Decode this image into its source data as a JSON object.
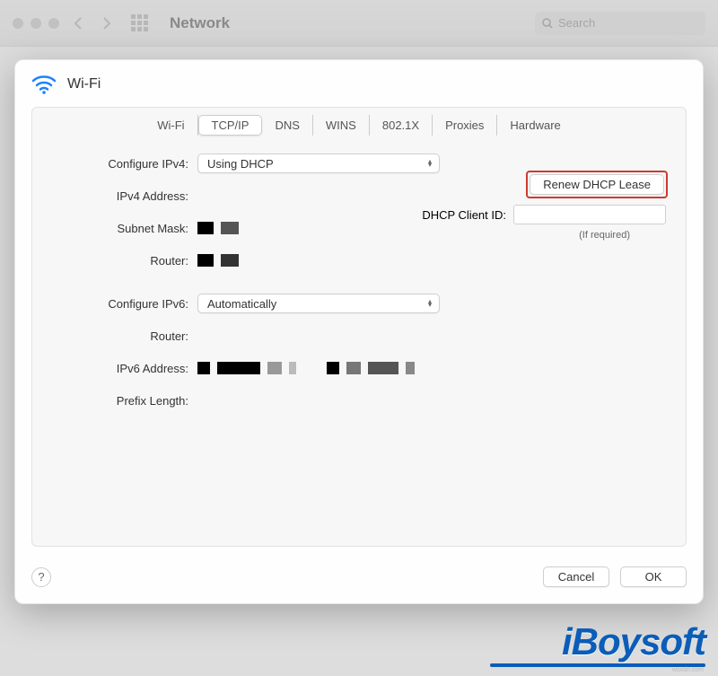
{
  "bgWindow": {
    "title": "Network",
    "searchPlaceholder": "Search"
  },
  "sheet": {
    "title": "Wi-Fi"
  },
  "tabs": {
    "items": [
      "Wi-Fi",
      "TCP/IP",
      "DNS",
      "WINS",
      "802.1X",
      "Proxies",
      "Hardware"
    ],
    "activeIndex": 1
  },
  "fields": {
    "configureIPv4": {
      "label": "Configure IPv4:",
      "value": "Using DHCP"
    },
    "ipv4Address": {
      "label": "IPv4 Address:"
    },
    "subnetMask": {
      "label": "Subnet Mask:"
    },
    "router4": {
      "label": "Router:"
    },
    "configureIPv6": {
      "label": "Configure IPv6:",
      "value": "Automatically"
    },
    "router6": {
      "label": "Router:"
    },
    "ipv6Address": {
      "label": "IPv6 Address:"
    },
    "prefixLength": {
      "label": "Prefix Length:"
    }
  },
  "dhcp": {
    "renewButton": "Renew DHCP Lease",
    "clientIdLabel": "DHCP Client ID:",
    "ifRequired": "(If required)"
  },
  "footer": {
    "help": "?",
    "cancel": "Cancel",
    "ok": "OK"
  },
  "watermark": {
    "text": "iBoysoft",
    "tiny": "wsxdn.com"
  }
}
